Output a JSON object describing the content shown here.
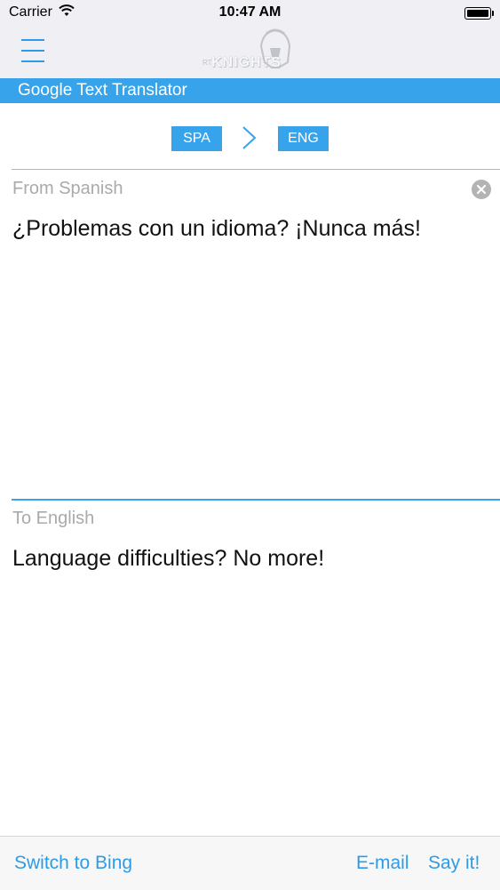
{
  "status_bar": {
    "carrier": "Carrier",
    "time": "10:47 AM"
  },
  "nav": {
    "logo_text": "KNIGHTS",
    "logo_sub": "RT"
  },
  "title": "Google Text Translator",
  "languages": {
    "from": "SPA",
    "to": "ENG"
  },
  "source": {
    "label": "From Spanish",
    "text": "¿Problemas con un idioma? ¡Nunca más!"
  },
  "target": {
    "label": "To English",
    "text": "Language difficulties? No more!"
  },
  "bottom_bar": {
    "switch_label": "Switch to Bing",
    "email_label": "E-mail",
    "say_label": "Say it!"
  },
  "colors": {
    "accent": "#36a3ea",
    "link": "#2e9be6",
    "label_gray": "#aaaaaa"
  }
}
